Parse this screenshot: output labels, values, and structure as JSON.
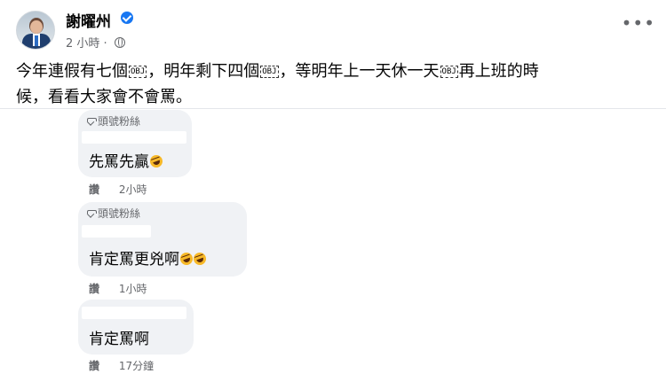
{
  "post": {
    "author": "謝曜州",
    "time": "2 小時",
    "separator": "·",
    "more_icon": "ellipsis-icon",
    "text_line1_parts": [
      "今年連假有七個",
      "，明年剩下四個",
      "，等明年上一天休一天",
      "再上班的時"
    ],
    "text_line2": "候，看看大家會不會罵。",
    "obj_glyph": "OBJ"
  },
  "comments": [
    {
      "badge": "頭號粉絲",
      "text": "先罵先贏",
      "emoji": "rolling-on-floor-laughing",
      "like_label": "讚",
      "time": "2小時"
    },
    {
      "badge": "頭號粉絲",
      "text": "肯定罵更兇啊",
      "emoji": "rolling-on-floor-laughing",
      "like_label": "讚",
      "time": "1小時"
    },
    {
      "text": "肯定罵啊",
      "like_label": "讚",
      "time": "17分鐘"
    }
  ],
  "colors": {
    "verified": "#1877f2",
    "bubble": "#f0f2f5",
    "secondary_text": "#65676b"
  }
}
